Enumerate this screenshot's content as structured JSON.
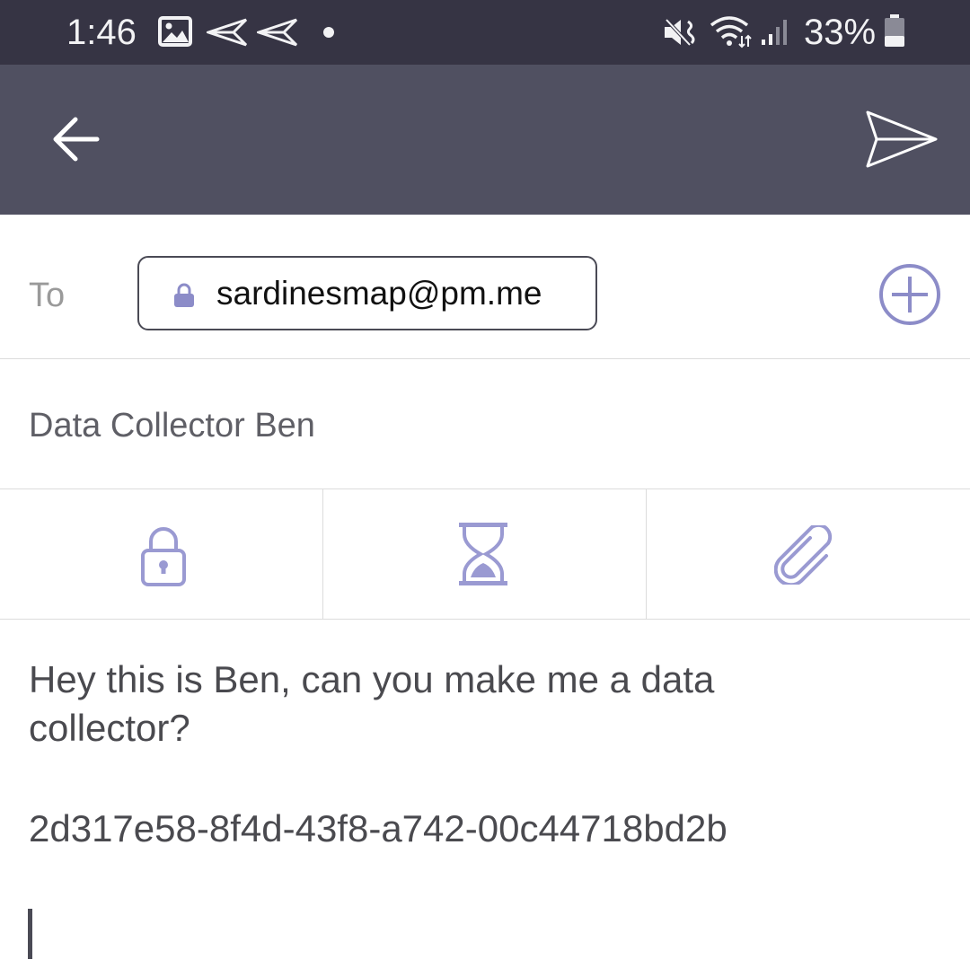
{
  "status_bar": {
    "time": "1:46",
    "battery": "33%",
    "icons": [
      "image-icon",
      "send-notification-icon",
      "send-notification-icon",
      "dot-icon",
      "mute-icon",
      "wifi-icon",
      "signal-icon",
      "battery-icon"
    ]
  },
  "app_bar": {
    "back_icon": "back-arrow-icon",
    "send_icon": "send-icon"
  },
  "compose": {
    "to_label": "To",
    "recipient": "sardinesmap@pm.me",
    "subject": "Data Collector Ben",
    "toolbar": [
      "lock-icon",
      "hourglass-icon",
      "paperclip-icon"
    ],
    "body_lines": [
      "Hey this is Ben, can you make me a data",
      "collector?",
      "",
      "2d317e58-8f4d-43f8-a742-00c44718bd2b"
    ]
  },
  "colors": {
    "status_bar": "#363444",
    "app_bar": "#505061",
    "accent": "#8c8cc8"
  }
}
